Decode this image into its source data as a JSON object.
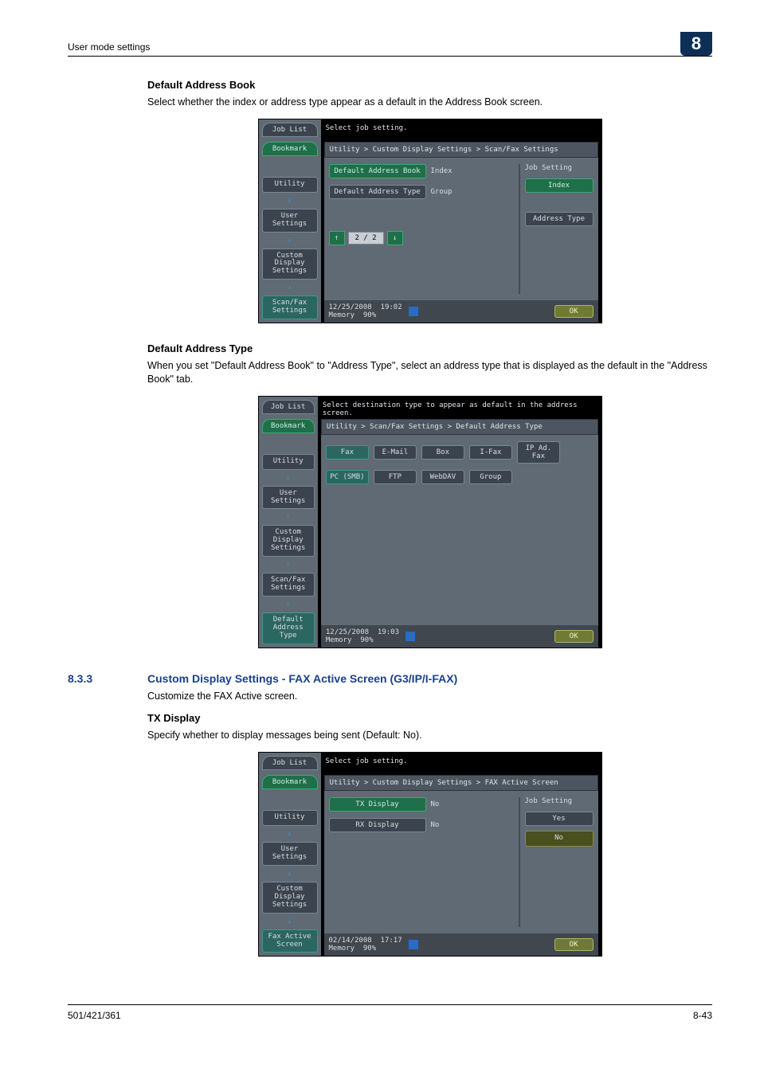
{
  "header": {
    "left": "User mode settings",
    "badge": "8"
  },
  "sec1": {
    "title": "Default Address Book",
    "text": "Select whether the index or address type appear as a default in the Address Book screen."
  },
  "sec2": {
    "title": "Default Address Type",
    "text": "When you set \"Default Address Book\" to \"Address Type\", select an address type that is displayed as the default in the \"Address Book\" tab."
  },
  "sec3": {
    "num": "8.3.3",
    "title": "Custom Display Settings - FAX Active Screen (G3/IP/I-FAX)",
    "text": "Customize the FAX Active screen."
  },
  "sec4": {
    "title": "TX Display",
    "text": "Specify whether to display messages being sent (Default: No)."
  },
  "screens": {
    "common": {
      "job_list": "Job List",
      "bookmark": "Bookmark",
      "utility": "Utility",
      "user_settings": "User Settings",
      "custom_display": "Custom Display\nSettings",
      "ok": "OK",
      "memory": "Memory",
      "memory_pct": "90%",
      "job_setting": "Job Setting"
    },
    "a": {
      "instr": "Select job setting.",
      "breadcrumb": "Utility > Custom Display Settings > Scan/Fax Settings",
      "nav4": "Scan/Fax\nSettings",
      "row1_label": "Default Address Book",
      "row1_value": "Index",
      "row2_label": "Default Address Type",
      "row2_value": "Group",
      "side1": "Index",
      "side2": "Address Type",
      "pager": "2 / 2",
      "date": "12/25/2008",
      "time": "19:02"
    },
    "b": {
      "instr": "Select destination type to appear as default in the address screen.",
      "breadcrumb": "Utility > Scan/Fax Settings > Default Address Type",
      "nav4": "Scan/Fax\nSettings",
      "nav5": "Default Address\nType",
      "chips1": [
        "Fax",
        "E-Mail",
        "Box",
        "I-Fax",
        "IP Ad.\nFax"
      ],
      "chips2": [
        "PC (SMB)",
        "FTP",
        "WebDAV",
        "Group"
      ],
      "date": "12/25/2008",
      "time": "19:03"
    },
    "c": {
      "instr": "Select job setting.",
      "breadcrumb": "Utility > Custom Display Settings > FAX Active Screen",
      "nav4": "Fax Active\nScreen",
      "row1_label": "TX Display",
      "row1_value": "No",
      "row2_label": "RX Display",
      "row2_value": "No",
      "side1": "Yes",
      "side2": "No",
      "date": "02/14/2008",
      "time": "17:17"
    }
  },
  "footer": {
    "left": "501/421/361",
    "right": "8-43"
  }
}
